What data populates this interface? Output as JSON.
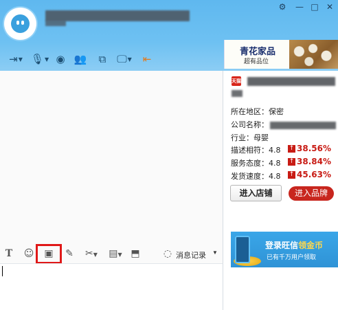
{
  "window": {
    "controls": [
      {
        "name": "settings",
        "glyph": "⚙"
      },
      {
        "name": "minimize",
        "glyph": "—"
      },
      {
        "name": "maximize",
        "glyph": "□"
      },
      {
        "name": "close",
        "glyph": "✕"
      }
    ]
  },
  "header_toolbar": {
    "icons": [
      "transfer-file-icon",
      "voice-icon",
      "video-icon",
      "contacts-icon",
      "screen-share-icon",
      "remote-assist-icon",
      "export-icon"
    ]
  },
  "ad_banner": {
    "title": "青花家品",
    "subtitle": "超有品位"
  },
  "message_toolbar": {
    "icons": [
      "font-icon",
      "emoji-icon",
      "image-icon",
      "edit-icon",
      "screenshot-icon",
      "more-icon",
      "screen-icon"
    ],
    "history_label": "消息记录"
  },
  "shop_info": {
    "badge": "天猫",
    "rows": [
      {
        "label": "所在地区：",
        "value": "保密"
      },
      {
        "label": "公司名称：",
        "value": ""
      },
      {
        "label": "行业：",
        "value": "母婴"
      }
    ],
    "ratings": [
      {
        "label": "描述相符：4.8",
        "percent": "38.56%"
      },
      {
        "label": "服务态度：4.8",
        "percent": "38.84%"
      },
      {
        "label": "发货速度：4.8",
        "percent": "45.63%"
      }
    ],
    "enter_shop_label": "进入店铺",
    "enter_brand_label": "进入品牌"
  },
  "promo": {
    "title_a": "登录旺信",
    "title_b": "领金币",
    "subtitle": "已有千万用户领取"
  },
  "colors": {
    "header_blue": "#6ec1f2",
    "accent_red": "#c81b14",
    "highlight_red": "#e01818"
  }
}
